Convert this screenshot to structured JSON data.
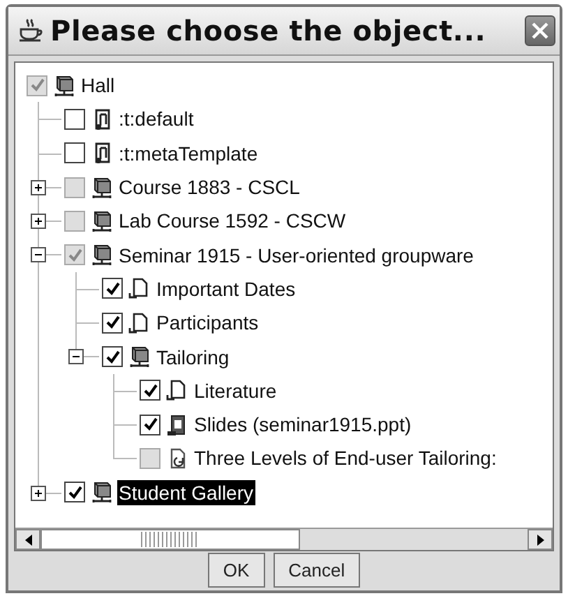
{
  "window": {
    "title": "Please choose the object..."
  },
  "tree": [
    {
      "label": "Hall",
      "kind": "room",
      "checked": true,
      "disabled": true,
      "selected": false,
      "children": [
        {
          "label": ":t:default",
          "kind": "template",
          "checked": false,
          "disabled": false,
          "selected": false
        },
        {
          "label": ":t:metaTemplate",
          "kind": "template",
          "checked": false,
          "disabled": false,
          "selected": false
        },
        {
          "label": "Course 1883 - CSCL",
          "kind": "room",
          "checked": false,
          "disabled": true,
          "selected": false,
          "expanded": false
        },
        {
          "label": "Lab Course 1592 - CSCW",
          "kind": "room",
          "checked": false,
          "disabled": true,
          "selected": false,
          "expanded": false
        },
        {
          "label": "Seminar 1915 - User-oriented groupware",
          "kind": "room",
          "checked": true,
          "disabled": true,
          "selected": false,
          "expanded": true,
          "children": [
            {
              "label": "Important Dates",
              "kind": "document",
              "checked": true,
              "disabled": false,
              "selected": false
            },
            {
              "label": "Participants",
              "kind": "document",
              "checked": true,
              "disabled": false,
              "selected": false
            },
            {
              "label": "Tailoring",
              "kind": "room",
              "checked": true,
              "disabled": false,
              "selected": false,
              "expanded": true,
              "children": [
                {
                  "label": "Literature",
                  "kind": "document",
                  "checked": true,
                  "disabled": false,
                  "selected": false
                },
                {
                  "label": "Slides (seminar1915.ppt)",
                  "kind": "slides",
                  "checked": true,
                  "disabled": false,
                  "selected": false
                },
                {
                  "label": "Three Levels of End-user Tailoring:",
                  "kind": "link",
                  "checked": false,
                  "disabled": true,
                  "selected": false
                }
              ]
            }
          ]
        },
        {
          "label": "Student Gallery",
          "kind": "room",
          "checked": true,
          "disabled": false,
          "selected": true,
          "expanded": false
        }
      ]
    }
  ],
  "buttons": [
    {
      "label": "OK"
    },
    {
      "label": "Cancel"
    }
  ]
}
